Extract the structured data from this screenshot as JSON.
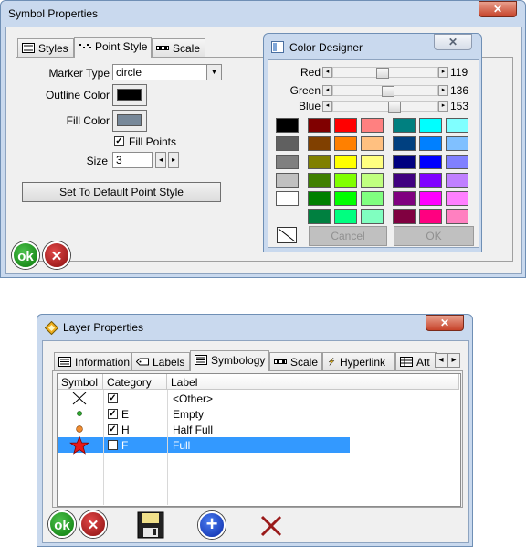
{
  "symbol_window": {
    "title": "Symbol Properties",
    "close": "✕",
    "tabs": [
      {
        "label": "Styles",
        "icon": "list-icon"
      },
      {
        "label": "Point Style",
        "icon": "points-icon"
      },
      {
        "label": "Scale",
        "icon": "scale-icon"
      }
    ],
    "marker_type_label": "Marker Type",
    "marker_type_value": "circle",
    "outline_color_label": "Outline Color",
    "outline_color": "#000000",
    "fill_color_label": "Fill Color",
    "fill_color": "#778899",
    "fill_points_label": "Fill Points",
    "fill_points_checked": "✓",
    "size_label": "Size",
    "size_value": "3",
    "default_button": "Set To Default Point Style",
    "ok_label": "ok",
    "cancel_label": "✕"
  },
  "color_designer": {
    "title": "Color Designer",
    "close": "✕",
    "red_label": "Red",
    "red_value": "119",
    "red": 119,
    "green_label": "Green",
    "green_value": "136",
    "green": 136,
    "blue_label": "Blue",
    "blue_value": "153",
    "blue": 153,
    "cancel_button": "Cancel",
    "ok_button": "OK",
    "grays": [
      "#000000",
      "#606060",
      "#808080",
      "#c0c0c0",
      "#ffffff"
    ],
    "palette_left": [
      [
        "#800000",
        "#ff0000",
        "#ff8080"
      ],
      [
        "#804000",
        "#ff8000",
        "#ffc080"
      ],
      [
        "#808000",
        "#ffff00",
        "#ffff80"
      ],
      [
        "#408000",
        "#80ff00",
        "#c0ff80"
      ],
      [
        "#008000",
        "#00ff00",
        "#80ff80"
      ],
      [
        "#008040",
        "#00ff80",
        "#80ffc0"
      ]
    ],
    "palette_right": [
      [
        "#008080",
        "#00ffff",
        "#80ffff"
      ],
      [
        "#004080",
        "#0080ff",
        "#80c0ff"
      ],
      [
        "#000080",
        "#0000ff",
        "#8080ff"
      ],
      [
        "#400080",
        "#8000ff",
        "#c080ff"
      ],
      [
        "#800080",
        "#ff00ff",
        "#ff80ff"
      ],
      [
        "#800040",
        "#ff0080",
        "#ff80c0"
      ]
    ]
  },
  "layer_window": {
    "title": "Layer Properties",
    "close": "✕",
    "tabs": [
      {
        "label": "Information",
        "icon": "info-icon"
      },
      {
        "label": "Labels",
        "icon": "label-icon"
      },
      {
        "label": "Symbology",
        "icon": "symbology-icon"
      },
      {
        "label": "Scale",
        "icon": "scale-icon"
      },
      {
        "label": "Hyperlink",
        "icon": "lightning-icon"
      },
      {
        "label": "Att",
        "icon": "table-icon"
      }
    ],
    "columns": [
      "Symbol",
      "Category",
      "Label"
    ],
    "rows": [
      {
        "symbol": "x-symbol",
        "checked": "✓",
        "category": "",
        "label": "<Other>"
      },
      {
        "symbol": "green-dot",
        "checked": "✓",
        "category": "E",
        "label": "Empty"
      },
      {
        "symbol": "orange-dot",
        "checked": "✓",
        "category": "H",
        "label": "Half Full"
      },
      {
        "symbol": "red-star",
        "checked": "✓",
        "category": "F",
        "label": "Full"
      }
    ],
    "ok_label": "ok",
    "cancel_label": "✕",
    "add_label": "+",
    "delete_label": "✕"
  }
}
